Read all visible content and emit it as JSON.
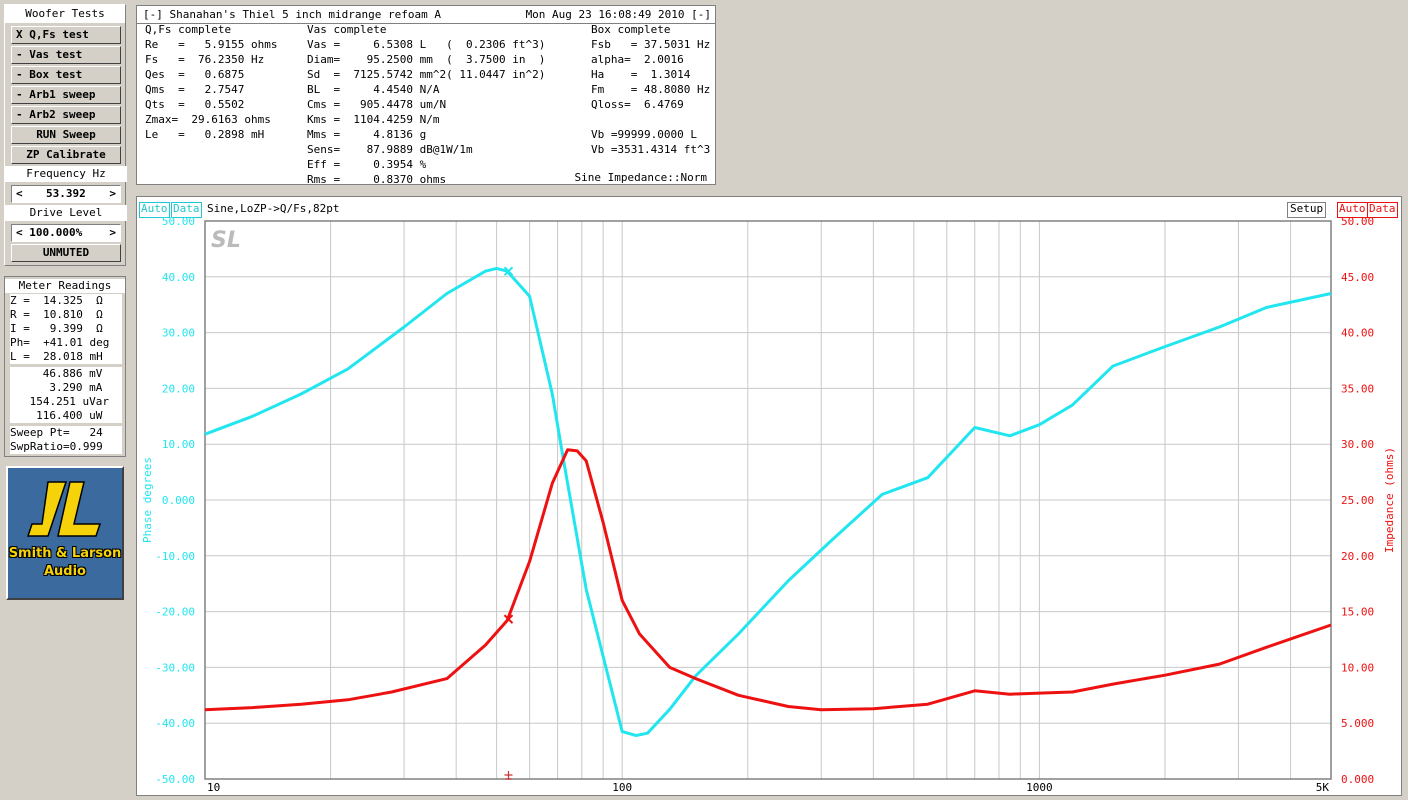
{
  "tests_panel": {
    "title": "Woofer Tests",
    "buttons": [
      {
        "label": "X Q,Fs test"
      },
      {
        "label": "- Vas test"
      },
      {
        "label": "- Box test"
      },
      {
        "label": "- Arb1 sweep"
      },
      {
        "label": "- Arb2 sweep"
      },
      {
        "label": "RUN Sweep"
      },
      {
        "label": "ZP Calibrate"
      }
    ],
    "frequency_label": "Frequency Hz",
    "frequency_left": "<",
    "frequency_value": "53.392",
    "frequency_right": ">",
    "drive_label": "Drive Level",
    "drive_value": "< 100.000%",
    "drive_right": ">",
    "mute_label": "UNMUTED"
  },
  "meter": {
    "title": "Meter Readings",
    "rows": [
      "Z =  14.325  Ω",
      "R =  10.810  Ω",
      "I =   9.399  Ω",
      "Ph=  +41.01 deg",
      "L =  28.018 mH",
      "  46.886 mV",
      "   3.290 mA",
      " 154.251 uVar",
      " 116.400 uW",
      "Sweep Pt=   24",
      "SwpRatio=0.999"
    ]
  },
  "logo": {
    "line1": "Smith & Larson",
    "line2": "Audio",
    "mark": "SL"
  },
  "params": {
    "title_left": "[-] Shanahan's Thiel 5 inch midrange refoam A",
    "title_right": "Mon Aug 23 16:08:49 2010 [-]",
    "col1_header": "Q,Fs complete",
    "col2_header": "Vas complete",
    "col3_header": "Box complete",
    "col1": [
      "Re   =   5.9155 ohms",
      "Fs   =  76.2350 Hz",
      "Qes  =   0.6875",
      "Qms  =   2.7547",
      "Qts  =   0.5502",
      "Zmax=  29.6163 ohms",
      "Le   =   0.2898 mH"
    ],
    "col2": [
      "Vas =     6.5308 L   (  0.2306 ft^3)",
      "Diam=    95.2500 mm  (  3.7500 in  )",
      "Sd  =  7125.5742 mm^2( 11.0447 in^2)",
      "BL  =     4.4540 N/A",
      "Cms =   905.4478 um/N",
      "Kms =  1104.4259 N/m",
      "Mms =     4.8136 g",
      "Sens=    87.9889 dB@1W/1m",
      "Eff =     0.3954 %",
      "Rms =     0.8370 ohms"
    ],
    "col3": [
      "Fsb   = 37.5031 Hz",
      "alpha=  2.0016",
      "Ha    =  1.3014",
      "Fm    = 48.8080 Hz",
      "Qloss=  6.4769",
      "",
      "Vb =99999.0000 L",
      "Vb =3531.4314 ft^3"
    ],
    "mode": "Sine Impedance::Norm"
  },
  "chart_header": {
    "left_auto": "Auto",
    "left_data": "Data",
    "description": "Sine,LoZP->Q/Fs,82pt",
    "setup": "Setup",
    "right_auto": "Auto",
    "right_data": "Data"
  },
  "colors": {
    "phase": "#22e6ef",
    "impedance": "#ee1111",
    "grid": "#c8c8c8",
    "frame": "#808080"
  },
  "chart_data": {
    "type": "line",
    "x_scale": "log",
    "xlim": [
      10,
      5000
    ],
    "x_ticks": [
      {
        "value": 10,
        "label": "10"
      },
      {
        "value": 100,
        "label": "100"
      },
      {
        "value": 1000,
        "label": "1000"
      },
      {
        "value": 5000,
        "label": "5K"
      }
    ],
    "ylabel_left": "Phase degrees",
    "ylim_left": [
      -50,
      50
    ],
    "y_ticks_left": [
      "50.00",
      "40.00",
      "30.00",
      "20.00",
      "10.00",
      "0.000",
      "-10.00",
      "-20.00",
      "-30.00",
      "-40.00",
      "-50.00"
    ],
    "ylabel_right": "Impedance (ohms)",
    "ylim_right": [
      0,
      50
    ],
    "y_ticks_right": [
      "50.00",
      "45.00",
      "40.00",
      "35.00",
      "30.00",
      "25.00",
      "20.00",
      "15.00",
      "10.00",
      "5.000",
      "0.000"
    ],
    "grid": true,
    "series": [
      {
        "axis": "left",
        "color": "#22e6ef",
        "points": [
          [
            10,
            11.8
          ],
          [
            13,
            15
          ],
          [
            17,
            19
          ],
          [
            22,
            23.5
          ],
          [
            30,
            31
          ],
          [
            38,
            37
          ],
          [
            47,
            41
          ],
          [
            50,
            41.5
          ],
          [
            53,
            41
          ],
          [
            60,
            36.5
          ],
          [
            68,
            19
          ],
          [
            72,
            8
          ],
          [
            76,
            -2
          ],
          [
            82,
            -16
          ],
          [
            90,
            -28
          ],
          [
            100,
            -41.5
          ],
          [
            108,
            -42.2
          ],
          [
            115,
            -41.8
          ],
          [
            130,
            -37.5
          ],
          [
            150,
            -31.5
          ],
          [
            190,
            -24
          ],
          [
            250,
            -14.5
          ],
          [
            320,
            -7
          ],
          [
            420,
            1
          ],
          [
            540,
            4
          ],
          [
            700,
            13
          ],
          [
            850,
            11.5
          ],
          [
            1000,
            13.5
          ],
          [
            1200,
            17
          ],
          [
            1500,
            24
          ],
          [
            2000,
            27.5
          ],
          [
            2700,
            31
          ],
          [
            3500,
            34.5
          ],
          [
            5000,
            37
          ]
        ]
      },
      {
        "axis": "right",
        "color": "#ee1111",
        "points": [
          [
            10,
            6.2
          ],
          [
            13,
            6.4
          ],
          [
            17,
            6.7
          ],
          [
            22,
            7.1
          ],
          [
            28,
            7.8
          ],
          [
            38,
            9
          ],
          [
            47,
            12
          ],
          [
            53,
            14.2
          ],
          [
            60,
            19.5
          ],
          [
            68,
            26.5
          ],
          [
            74,
            29.5
          ],
          [
            78,
            29.4
          ],
          [
            82,
            28.5
          ],
          [
            90,
            23
          ],
          [
            100,
            16
          ],
          [
            110,
            13
          ],
          [
            130,
            10
          ],
          [
            150,
            9
          ],
          [
            190,
            7.5
          ],
          [
            250,
            6.5
          ],
          [
            300,
            6.2
          ],
          [
            400,
            6.3
          ],
          [
            540,
            6.7
          ],
          [
            700,
            7.9
          ],
          [
            850,
            7.6
          ],
          [
            1000,
            7.7
          ],
          [
            1200,
            7.8
          ],
          [
            1500,
            8.5
          ],
          [
            2000,
            9.3
          ],
          [
            2700,
            10.3
          ],
          [
            3500,
            11.8
          ],
          [
            5000,
            13.8
          ]
        ]
      }
    ],
    "markers": [
      {
        "axis": "left",
        "x": 53.392,
        "y": 41.01,
        "color": "#22e6ef"
      },
      {
        "axis": "right",
        "x": 53.392,
        "y": 14.325,
        "color": "#ee1111"
      }
    ]
  }
}
